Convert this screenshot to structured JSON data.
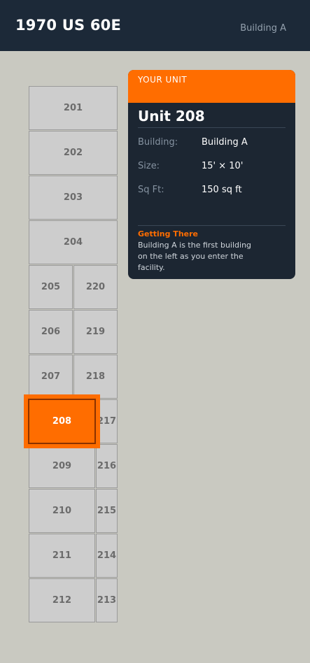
{
  "header": {
    "title": "1970 US 60E",
    "building": "Building A"
  },
  "units": {
    "u201": "201",
    "u202": "202",
    "u203": "203",
    "u204": "204",
    "u205": "205",
    "u206": "206",
    "u207": "207",
    "u208": "208",
    "u209": "209",
    "u210": "210",
    "u211": "211",
    "u212": "212",
    "u213": "213",
    "u214": "214",
    "u215": "215",
    "u216": "216",
    "u217": "217",
    "u218": "218",
    "u219": "219",
    "u220": "220"
  },
  "selected_unit": "208",
  "card": {
    "heading": "YOUR UNIT",
    "unit_name": "Unit 208",
    "rows": [
      {
        "label": "Building:",
        "value": "Building A"
      },
      {
        "label": "Size:",
        "value": "15' × 10'"
      },
      {
        "label": "Sq Ft:",
        "value": "150 sq ft"
      }
    ],
    "directions_title": "Getting There",
    "directions_text": "Building A is the first building on the left as you enter the facility."
  },
  "colors": {
    "accent": "#ff6d00",
    "header_bg": "#1c2938",
    "card_bg": "#1c2632",
    "page_bg": "#c9c9c1"
  }
}
